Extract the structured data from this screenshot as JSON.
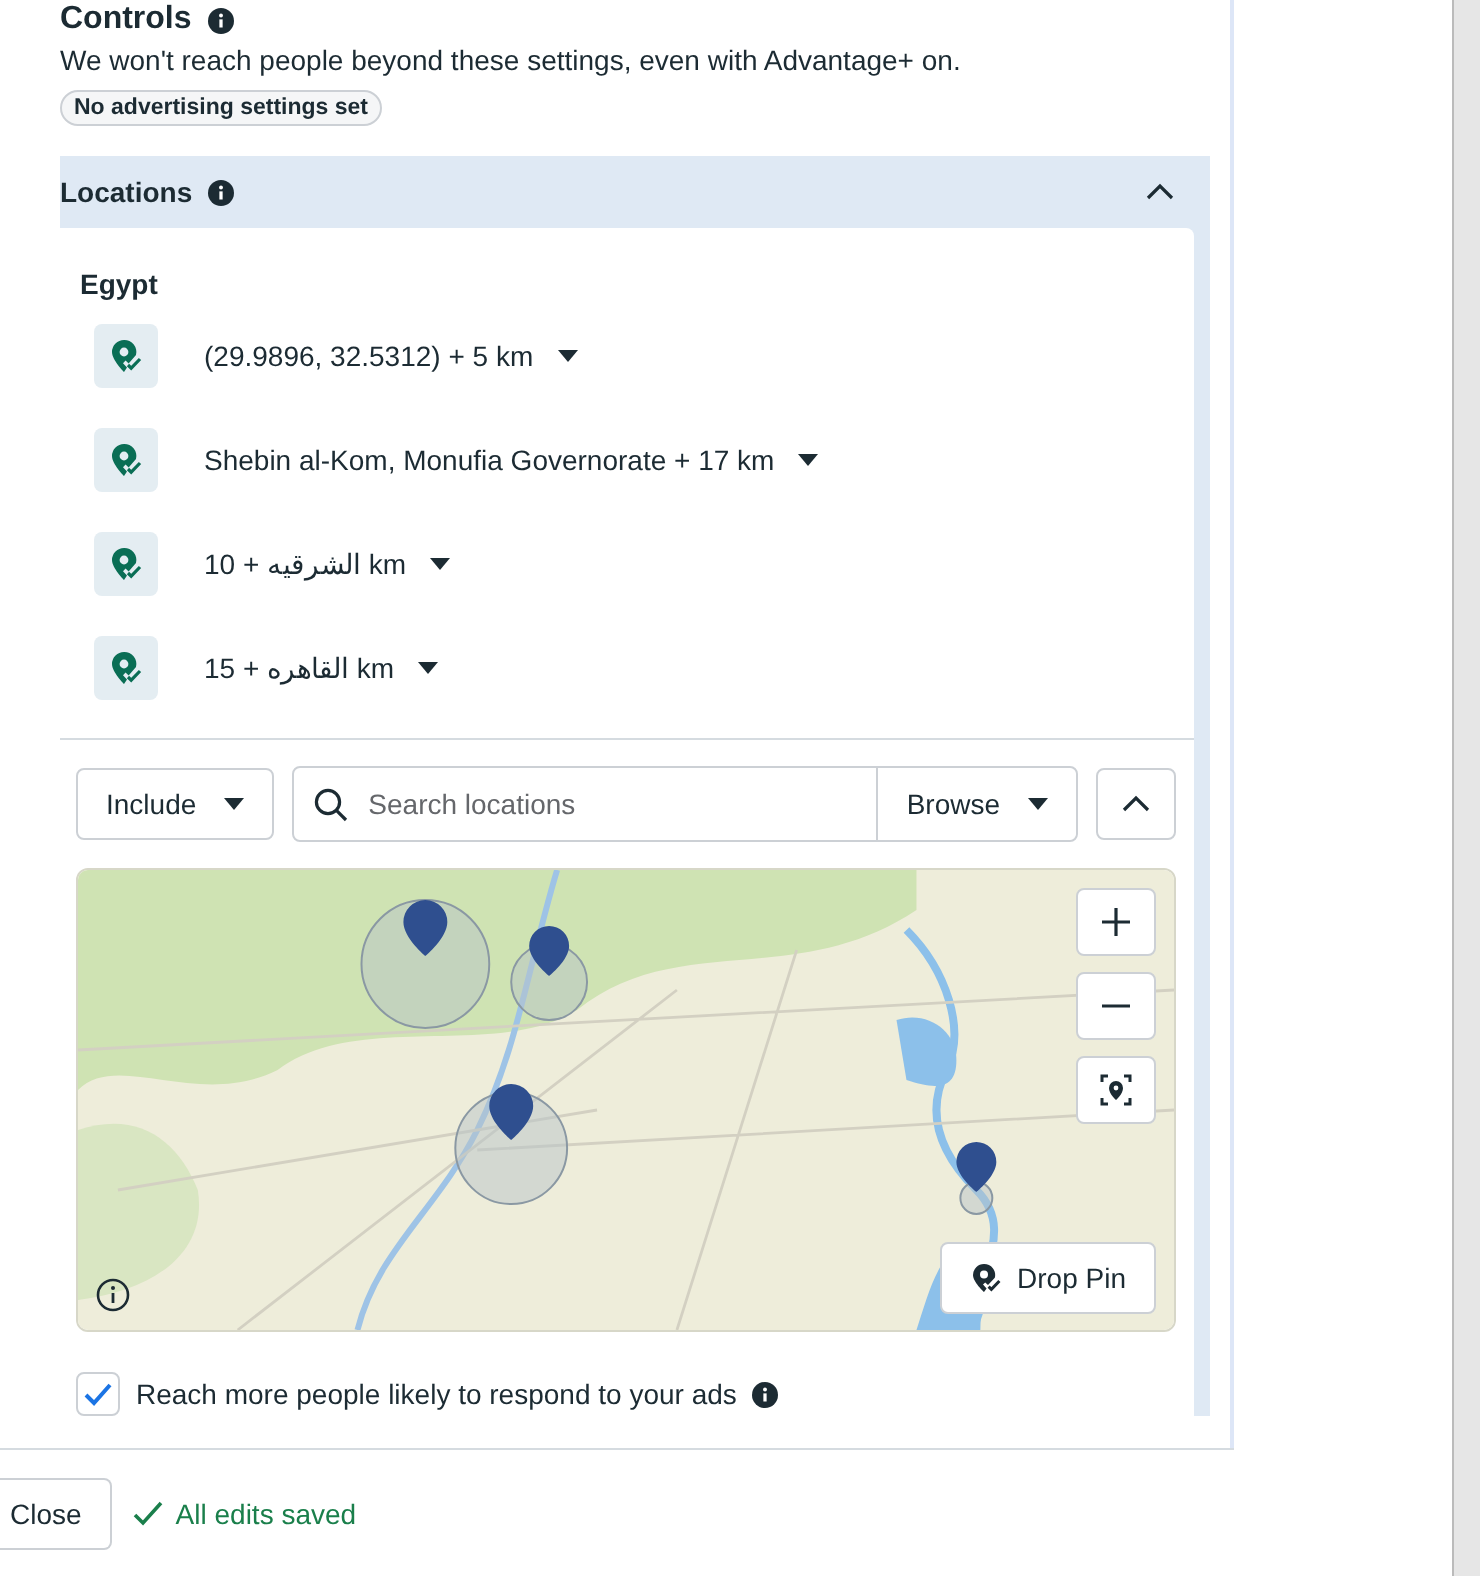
{
  "header": {
    "title": "Controls",
    "description": "We won't reach people beyond these settings, even with Advantage+ on.",
    "badge": "No advertising settings set"
  },
  "locations": {
    "title": "Locations",
    "expanded": true,
    "country": "Egypt",
    "items": [
      {
        "label": "(29.9896, 32.5312) + 5 km"
      },
      {
        "label": "Shebin al-Kom, Monufia Governorate + 17 km"
      },
      {
        "label": "10 + الشرقيه km"
      },
      {
        "label": "15 + القاهره km"
      }
    ],
    "include": "Include",
    "search": {
      "placeholder": "Search locations"
    },
    "browse": "Browse",
    "drop_pin": "Drop Pin"
  },
  "reach": {
    "label": "Reach more people likely to respond to your ads",
    "checked": true
  },
  "footer": {
    "close": "Close",
    "status": "All edits saved"
  }
}
